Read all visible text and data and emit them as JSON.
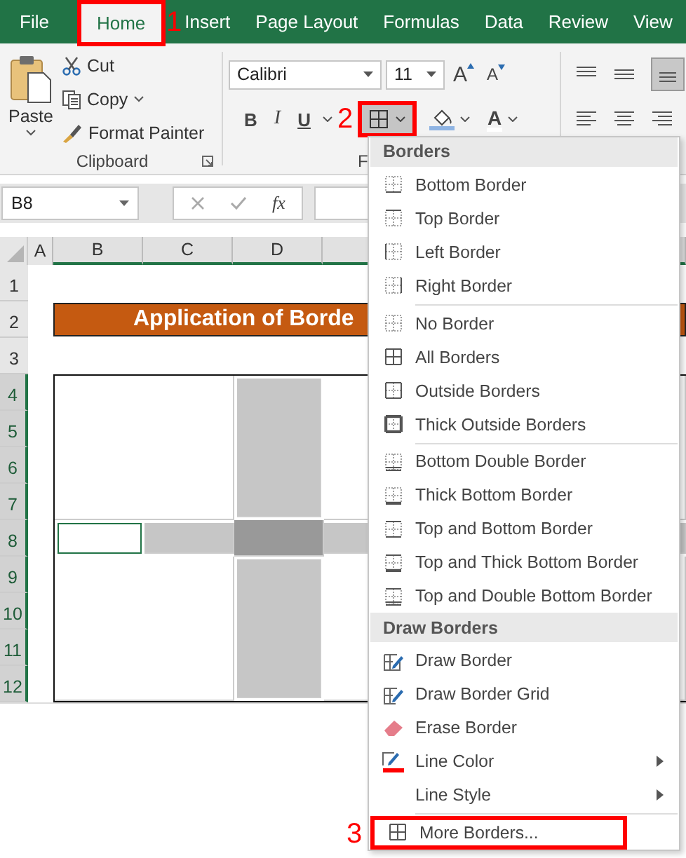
{
  "ribbon_tabs": [
    {
      "label": "File",
      "selected": false
    },
    {
      "label": "Home",
      "selected": true,
      "callout": "1"
    },
    {
      "label": "Insert",
      "selected": false
    },
    {
      "label": "Page Layout",
      "selected": false
    },
    {
      "label": "Formulas",
      "selected": false
    },
    {
      "label": "Data",
      "selected": false
    },
    {
      "label": "Review",
      "selected": false
    },
    {
      "label": "View",
      "selected": false
    }
  ],
  "clipboard": {
    "paste": "Paste",
    "cut": "Cut",
    "copy": "Copy",
    "format_painter": "Format Painter",
    "label": "Clipboard"
  },
  "font": {
    "name": "Calibri",
    "size": "11",
    "grow": "A",
    "shrink": "A",
    "bold": "B",
    "italic": "I",
    "underline": "U",
    "borders_callout": "2",
    "font_color": "A",
    "label": "F"
  },
  "formula_bar": {
    "name_box": "B8",
    "function": "fx"
  },
  "columns": [
    "A",
    "B",
    "C",
    "D"
  ],
  "rows": [
    "1",
    "2",
    "3",
    "4",
    "5",
    "6",
    "7",
    "8",
    "9",
    "10",
    "11",
    "12"
  ],
  "title_cell": "Application of Borde",
  "range": {
    "top": [
      {
        "kind": "plain"
      },
      {
        "kind": "shaded"
      },
      {
        "kind": "plain"
      }
    ],
    "middle": [
      {
        "kind": "plain",
        "selected": true
      },
      {
        "kind": "shaded",
        "selected": false
      },
      {
        "kind": "dark"
      },
      {
        "kind": "shaded",
        "selected": false
      }
    ],
    "bottom": [
      {
        "kind": "plain"
      },
      {
        "kind": "shaded"
      },
      {
        "kind": "plain"
      }
    ]
  },
  "borders_menu": {
    "sections": [
      {
        "title": "Borders",
        "groups": [
          [
            {
              "label": "Bottom Border",
              "kind": "bottom"
            },
            {
              "label": "Top Border",
              "kind": "top"
            },
            {
              "label": "Left Border",
              "kind": "left"
            },
            {
              "label": "Right Border",
              "kind": "right"
            }
          ],
          [
            {
              "label": "No Border",
              "kind": "none"
            },
            {
              "label": "All Borders",
              "kind": "all"
            },
            {
              "label": "Outside Borders",
              "kind": "outside"
            },
            {
              "label": "Thick Outside Borders",
              "kind": "thick-outside"
            }
          ],
          [
            {
              "label": "Bottom Double Border",
              "kind": "bottom-double"
            },
            {
              "label": "Thick Bottom Border",
              "kind": "thick-bottom"
            },
            {
              "label": "Top and Bottom Border",
              "kind": "top-bottom"
            },
            {
              "label": "Top and Thick Bottom Border",
              "kind": "top-thick-bottom"
            },
            {
              "label": "Top and Double Bottom Border",
              "kind": "top-double-bottom"
            }
          ]
        ]
      },
      {
        "title": "Draw Borders",
        "groups": [
          [
            {
              "label": "Draw Border",
              "kind": "draw"
            },
            {
              "label": "Draw Border Grid",
              "kind": "draw-grid"
            },
            {
              "label": "Erase Border",
              "kind": "erase"
            },
            {
              "label": "Line Color",
              "kind": "line-color",
              "submenu": true
            },
            {
              "label": "Line Style",
              "kind": "line-style",
              "submenu": true
            }
          ],
          [
            {
              "label": "More Borders...",
              "kind": "all",
              "callout": "3"
            }
          ]
        ]
      }
    ]
  }
}
